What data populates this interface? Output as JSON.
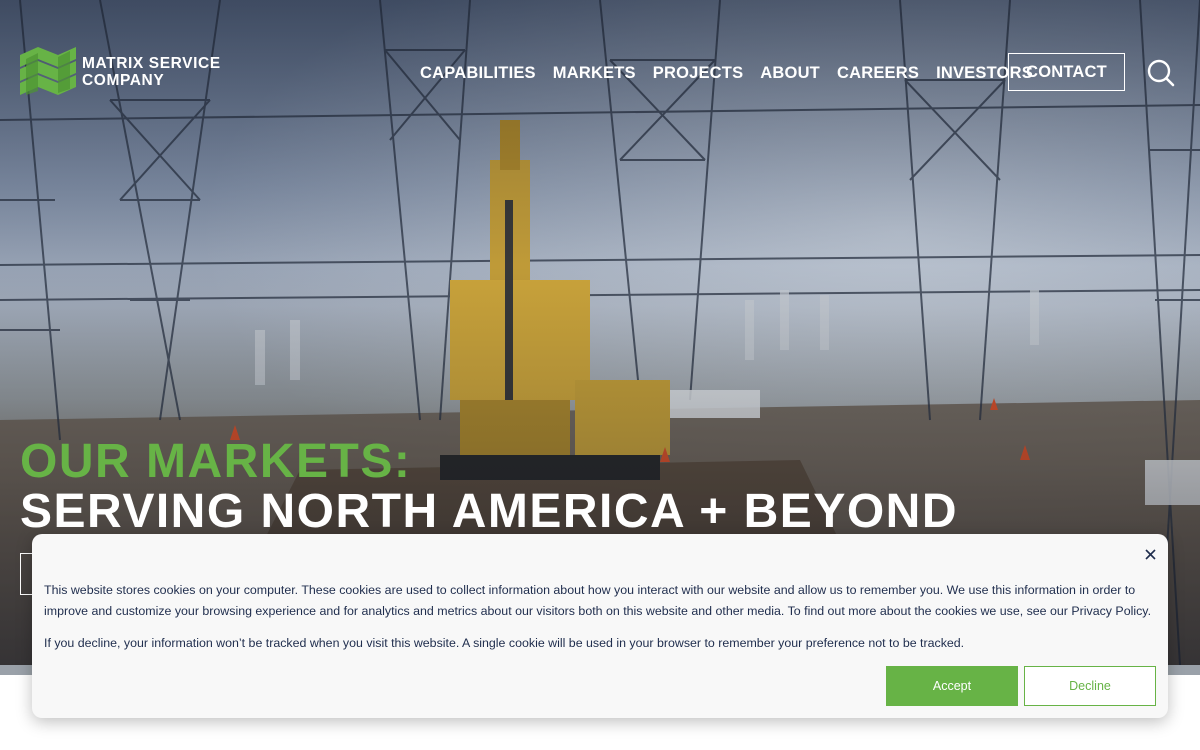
{
  "header": {
    "logo": {
      "line1": "MATRIX SERVICE",
      "line2": "COMPANY",
      "icon": "matrix-logo-mark"
    },
    "nav": [
      {
        "label": "CAPABILITIES"
      },
      {
        "label": "MARKETS"
      },
      {
        "label": "PROJECTS"
      },
      {
        "label": "ABOUT"
      },
      {
        "label": "CAREERS"
      },
      {
        "label": "INVESTORS"
      }
    ],
    "contact_label": "CONTACT",
    "search_icon": "search-icon"
  },
  "hero": {
    "eyebrow": "OUR MARKETS:",
    "title": "SERVING NORTH AMERICA + BEYOND"
  },
  "cookie": {
    "text1": "This website stores cookies on your computer. These cookies are used to collect information about how you interact with our website and allow us to remember you. We use this information in order to improve and customize your browsing experience and for analytics and metrics about our visitors both on this website and other media. To find out more about the cookies we use, see our Privacy Policy.",
    "text2": "If you decline, your information won’t be tracked when you visit this website. A single cookie will be used in your browser to remember your preference not to be tracked.",
    "accept_label": "Accept",
    "decline_label": "Decline",
    "close_icon": "close-icon"
  },
  "colors": {
    "brand_green": "#67b346",
    "text_navy": "#1f2d4d",
    "white": "#ffffff"
  }
}
